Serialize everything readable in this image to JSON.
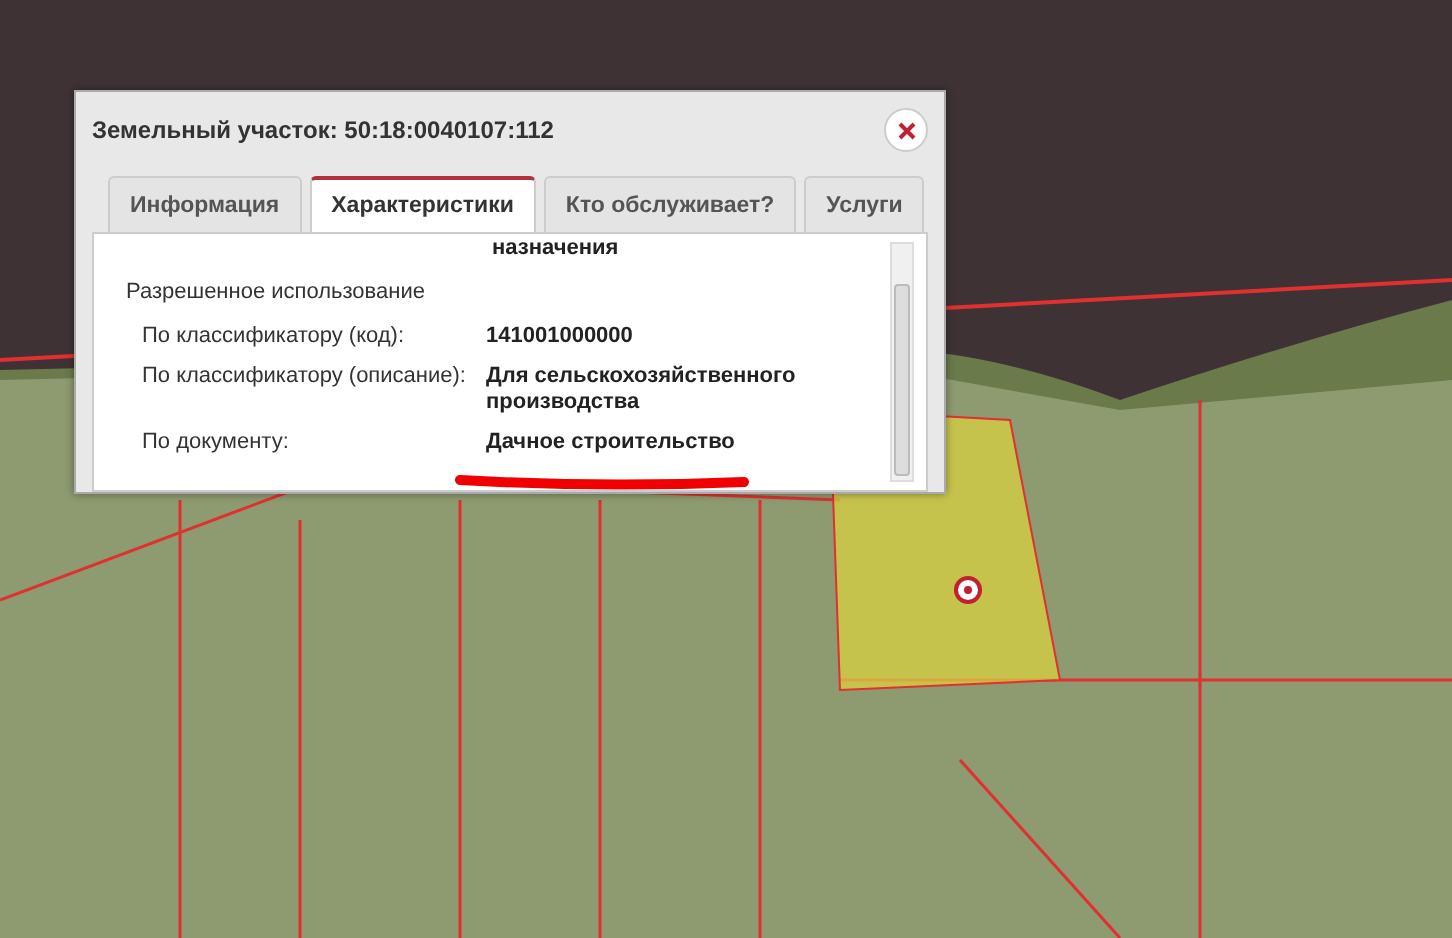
{
  "popup": {
    "title": "Земельный участок: 50:18:0040107:112",
    "tabs": [
      {
        "label": "Информация",
        "selected": false
      },
      {
        "label": "Характеристики",
        "selected": true
      },
      {
        "label": "Кто обслуживает?",
        "selected": false
      },
      {
        "label": "Услуги",
        "selected": false
      }
    ],
    "cut_text": "назначения",
    "section": "Разрешенное использование",
    "rows": [
      {
        "label": "По классификатору (код):",
        "value": "141001000000"
      },
      {
        "label": "По классификатору (описание):",
        "value": "Для сельскохозяйственного производства"
      },
      {
        "label": "По документу:",
        "value": "Дачное строительство"
      }
    ]
  }
}
